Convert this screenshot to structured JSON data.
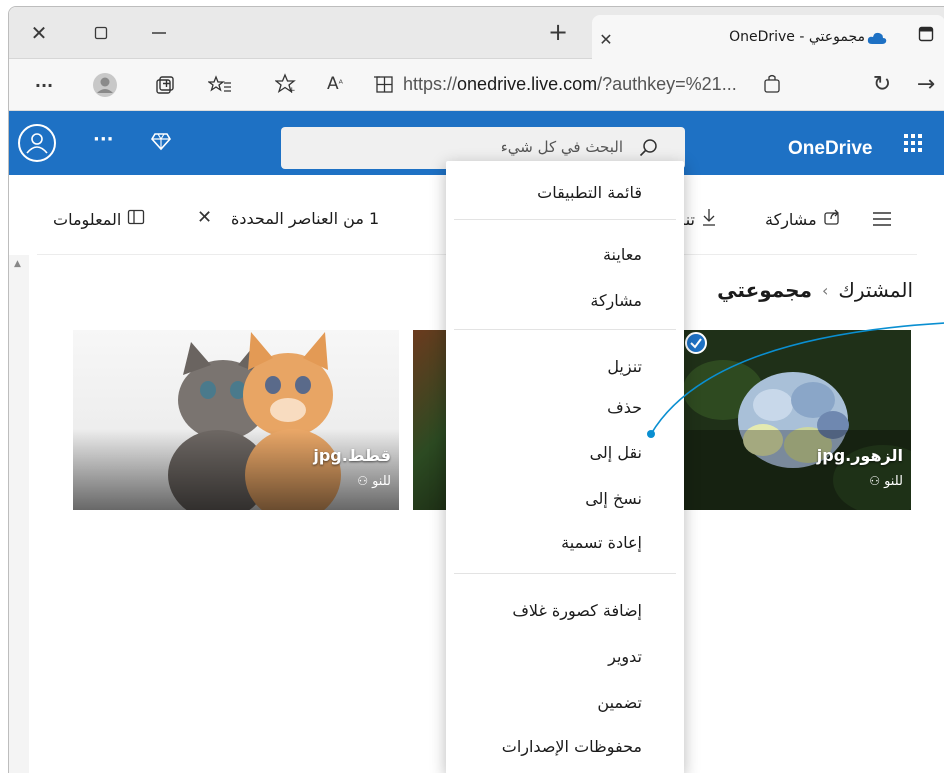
{
  "browser": {
    "tab_title": "مجموعتي - OneDrive",
    "new_tab_label": "+",
    "url": "https://onedrive.live.com/?authkey=%21...",
    "url_host": "onedrive.live.com",
    "url_prefix": "https://",
    "url_suffix": "/?authkey=%21...",
    "icons": [
      "close-window-icon",
      "maximize-icon",
      "minimize-icon",
      "new-tab-icon",
      "tab-close-icon",
      "onedrive-cloud-icon",
      "tab-actions-icon",
      "more-icon",
      "profile-icon",
      "collections-icon",
      "favorites-icon",
      "add-favorite-icon",
      "read-aloud-icon",
      "immersive-reader-icon",
      "app-available-icon",
      "refresh-icon",
      "forward-icon"
    ],
    "more_label": "···"
  },
  "suite": {
    "brand": "OneDrive",
    "search_placeholder": "البحث في كل شيء",
    "more_label": "···",
    "accent": "#1e71c4"
  },
  "commandbar": {
    "share": "مشاركة",
    "download_partial": "تنز",
    "selection": "1 من العناصر المحددة",
    "info": "المعلومات"
  },
  "breadcrumb": {
    "root": "المشترك",
    "separator": "›",
    "current": "مجموعتي"
  },
  "tiles": [
    {
      "name": "الزهور.jpg",
      "shared": "للنو"
    },
    {
      "name": "قطط.jpg",
      "shared": "للنو"
    }
  ],
  "context_menu": {
    "items": [
      "قائمة التطبيقات",
      "معاينة",
      "مشاركة",
      "تنزيل",
      "حذف",
      "نقل إلى",
      "نسخ إلى",
      "إعادة تسمية",
      "إضافة كصورة غلاف",
      "تدوير",
      "تضمين",
      "محفوظات الإصدارات"
    ]
  },
  "colors": {
    "suite_blue": "#1e71c4",
    "callout_line": "#0a8fd1"
  }
}
